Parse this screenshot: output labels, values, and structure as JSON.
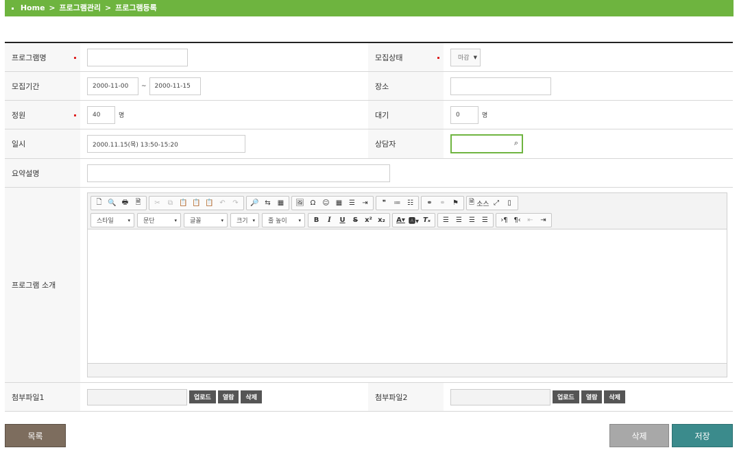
{
  "breadcrumb": {
    "items": [
      "Home",
      "프로그램관리",
      "프로그램등록"
    ],
    "separator": ">"
  },
  "form": {
    "program_name": {
      "label": "프로그램명",
      "value": ""
    },
    "recruit_status": {
      "label": "모집상태",
      "selected": "마감"
    },
    "recruit_period": {
      "label": "모집기간",
      "start": "2000-11-00",
      "end": "2000-11-15",
      "tilde": "~"
    },
    "venue": {
      "label": "장소",
      "value": ""
    },
    "capacity": {
      "label": "정원",
      "value": "40",
      "unit": "명"
    },
    "waiting": {
      "label": "대기",
      "value": "0",
      "unit": "명"
    },
    "datetime": {
      "label": "일시",
      "value": "2000.11.15(목) 13:50-15:20"
    },
    "counselor": {
      "label": "상담자",
      "value": ""
    },
    "summary": {
      "label": "요약설명",
      "value": ""
    },
    "intro": {
      "label": "프로그램 소개"
    },
    "attach1": {
      "label": "첨부파일1"
    },
    "attach2": {
      "label": "첨부파일2"
    }
  },
  "file_buttons": {
    "upload": "업로드",
    "view": "열람",
    "delete": "삭제"
  },
  "editor": {
    "source_label": "소스",
    "style_combo": "스타일",
    "paragraph_combo": "문단",
    "font_combo": "글꼴",
    "size_combo": "크기",
    "lineheight_combo": "줄 높이"
  },
  "actions": {
    "list": "목록",
    "delete": "삭제",
    "save": "저장"
  },
  "colors": {
    "accent_green": "#6eb43f",
    "save_teal": "#3b8b8c",
    "list_brown": "#7d6d5e",
    "required_red": "#dd2222"
  }
}
